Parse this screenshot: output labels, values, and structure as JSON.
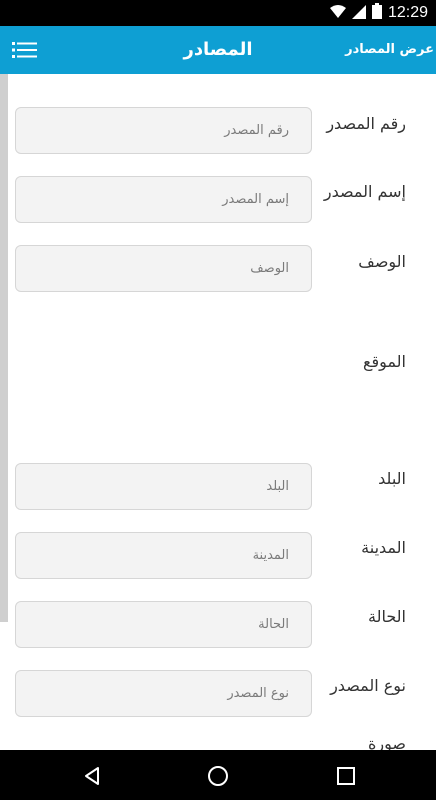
{
  "status_bar": {
    "time": "12:29",
    "icons": [
      "wifi-icon",
      "signal-icon",
      "battery-icon"
    ]
  },
  "app_bar": {
    "title": "المصادر",
    "view_link": "عرض المصادر",
    "menu_icon": "menu-icon",
    "color": "#0e9fd3"
  },
  "form": {
    "fields": [
      {
        "label": "رقم المصدر",
        "placeholder": "رقم المصدر"
      },
      {
        "label": "إسم المصدر",
        "placeholder": "إسم المصدر"
      },
      {
        "label": "الوصف",
        "placeholder": "الوصف"
      },
      {
        "label": "الموقع"
      },
      {
        "label": "البلد",
        "placeholder": "البلد"
      },
      {
        "label": "المدينة",
        "placeholder": "المدينة"
      },
      {
        "label": "الحالة",
        "placeholder": "الحالة"
      },
      {
        "label": "نوع المصدر",
        "placeholder": "نوع المصدر"
      },
      {
        "label": "صورة"
      }
    ]
  },
  "nav_bar": {
    "icons": [
      "back-icon",
      "home-icon",
      "recents-icon"
    ]
  }
}
